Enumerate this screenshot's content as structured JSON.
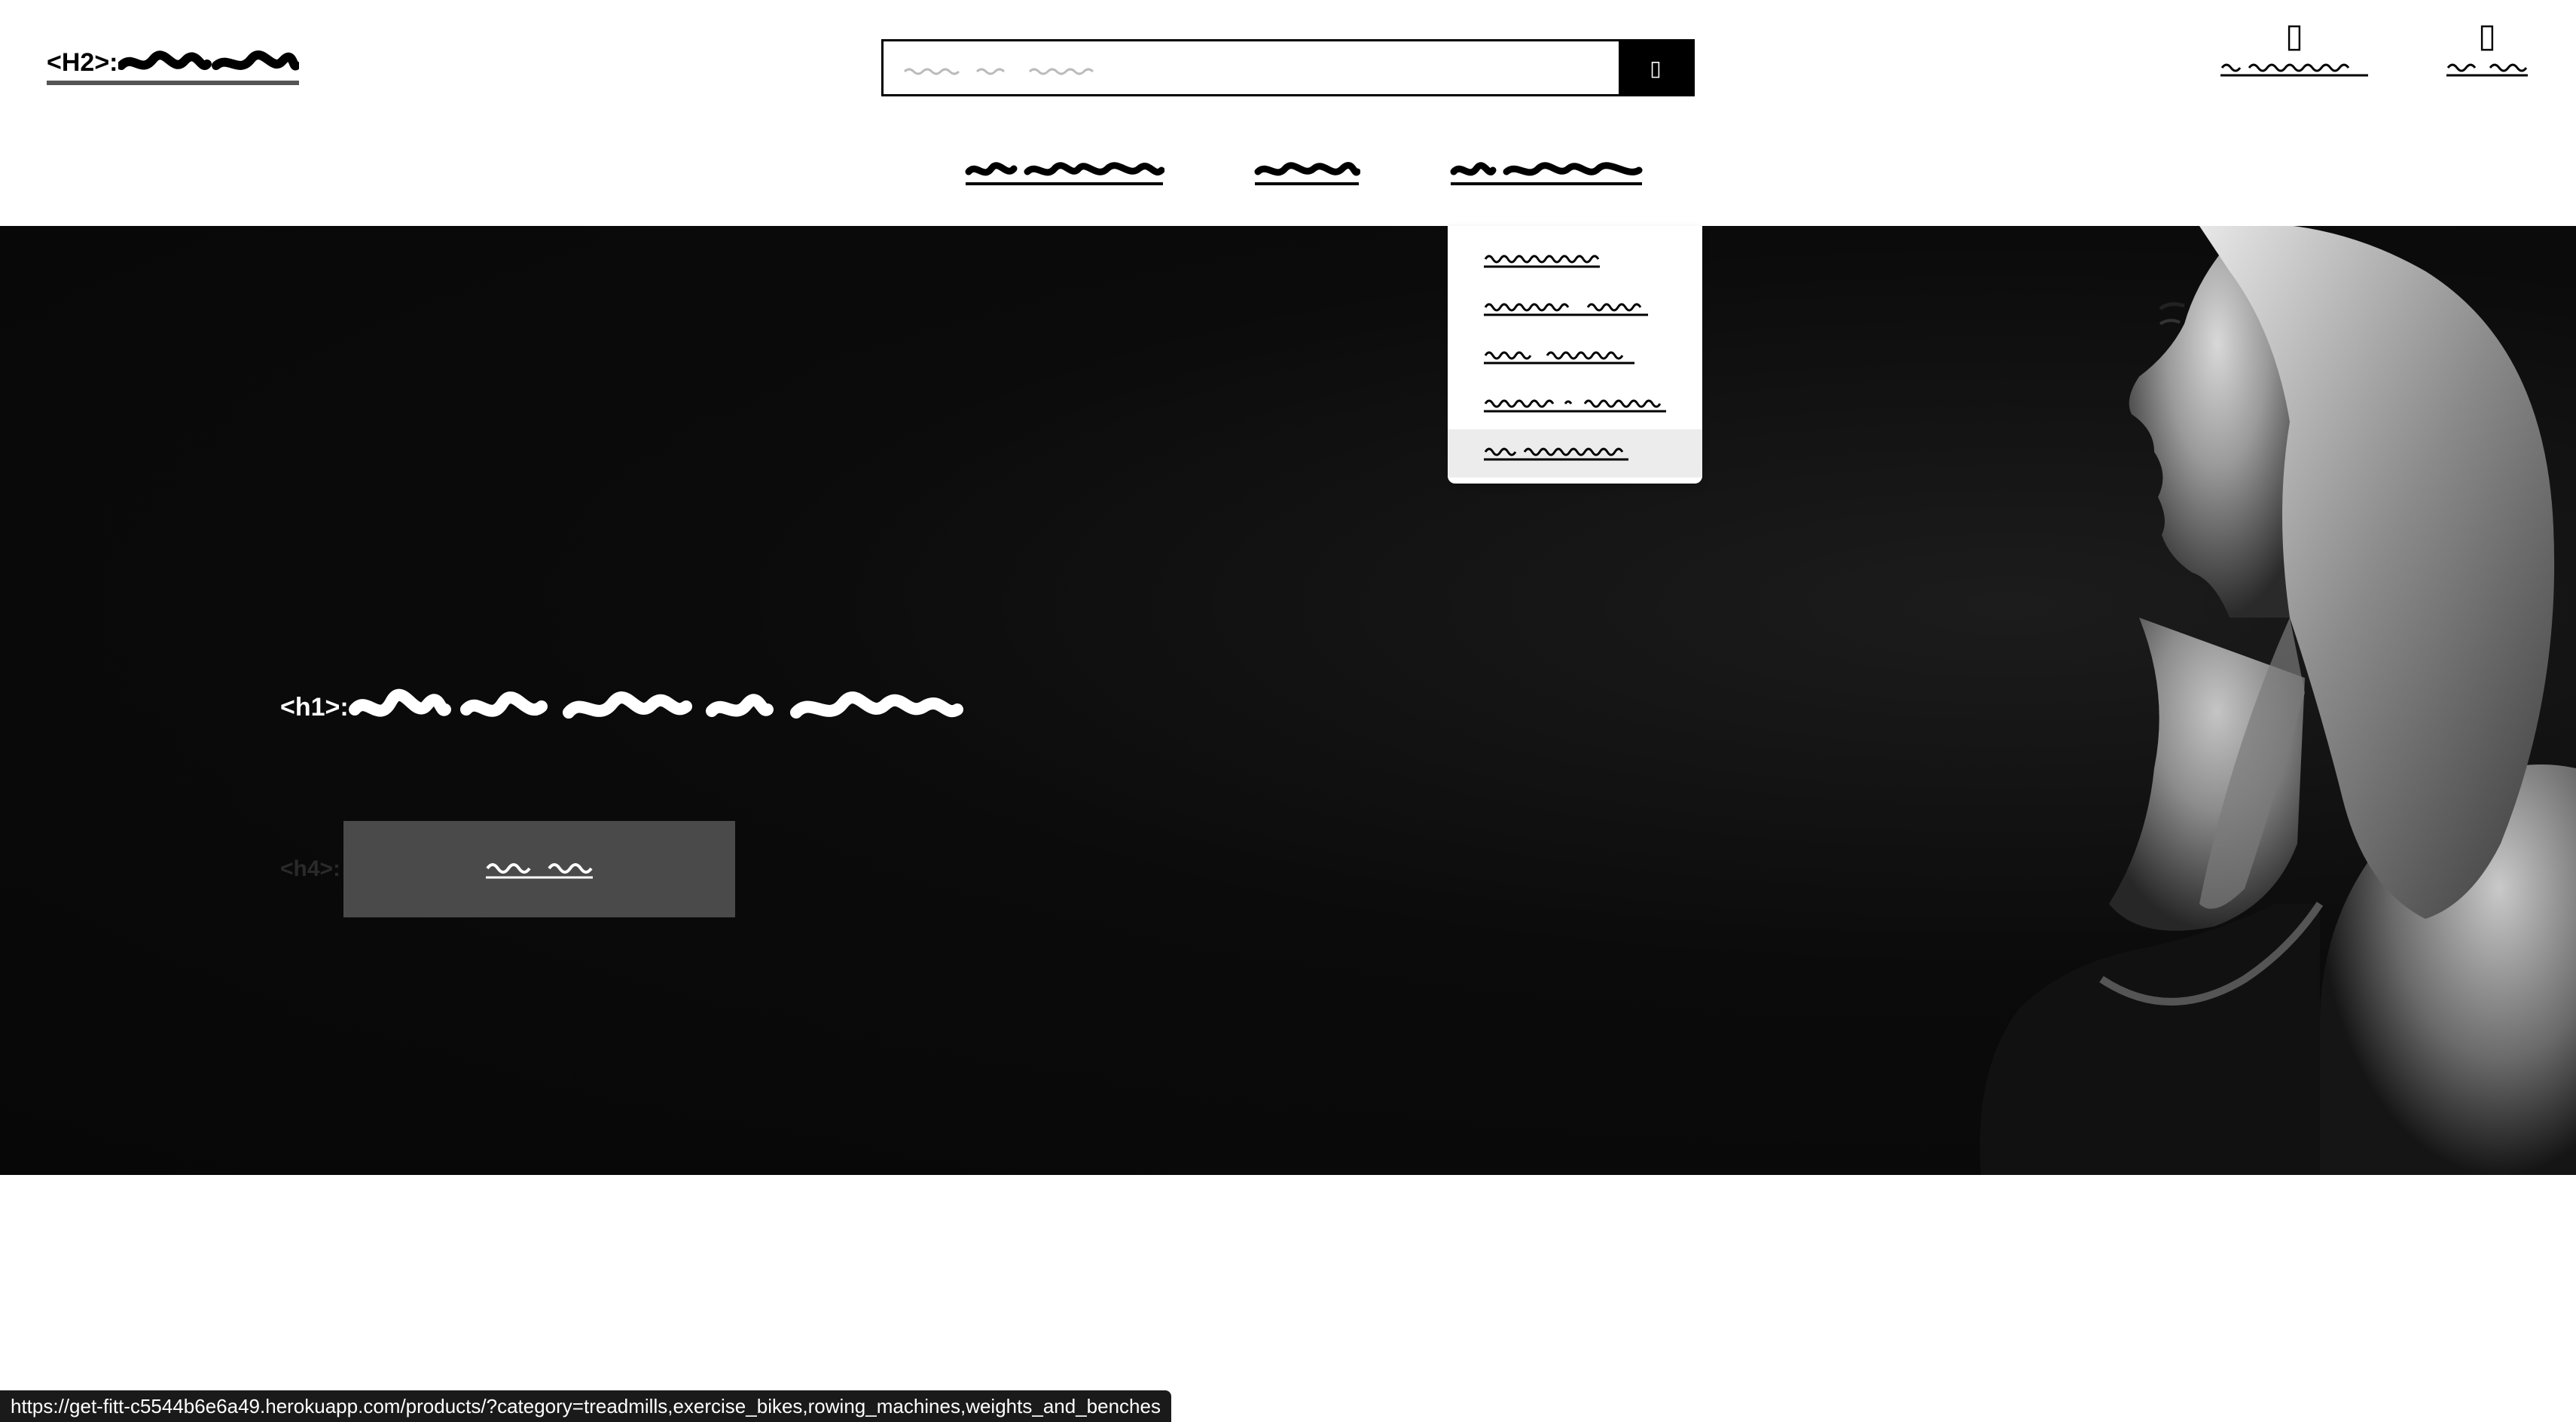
{
  "header": {
    "logo": {
      "tag": "<H2>:"
    },
    "account": [
      {
        "icon": "user-icon",
        "glyph": "▯"
      },
      {
        "icon": "cart-icon",
        "glyph": "▯"
      }
    ]
  },
  "hero": {
    "h1_tag": "<h1>:",
    "h4_tag": "<h4>:"
  },
  "dropdown": {
    "hovered_index": 4
  },
  "statusbar": {
    "url": "https://get-fitt-c5544b6e6a49.herokuapp.com/products/?category=treadmills,exercise_bikes,rowing_machines,weights_and_benches"
  },
  "colors": {
    "hero_bg": "#080808",
    "button_bg": "#4a4a4a",
    "dropdown_hover": "#ececec"
  }
}
